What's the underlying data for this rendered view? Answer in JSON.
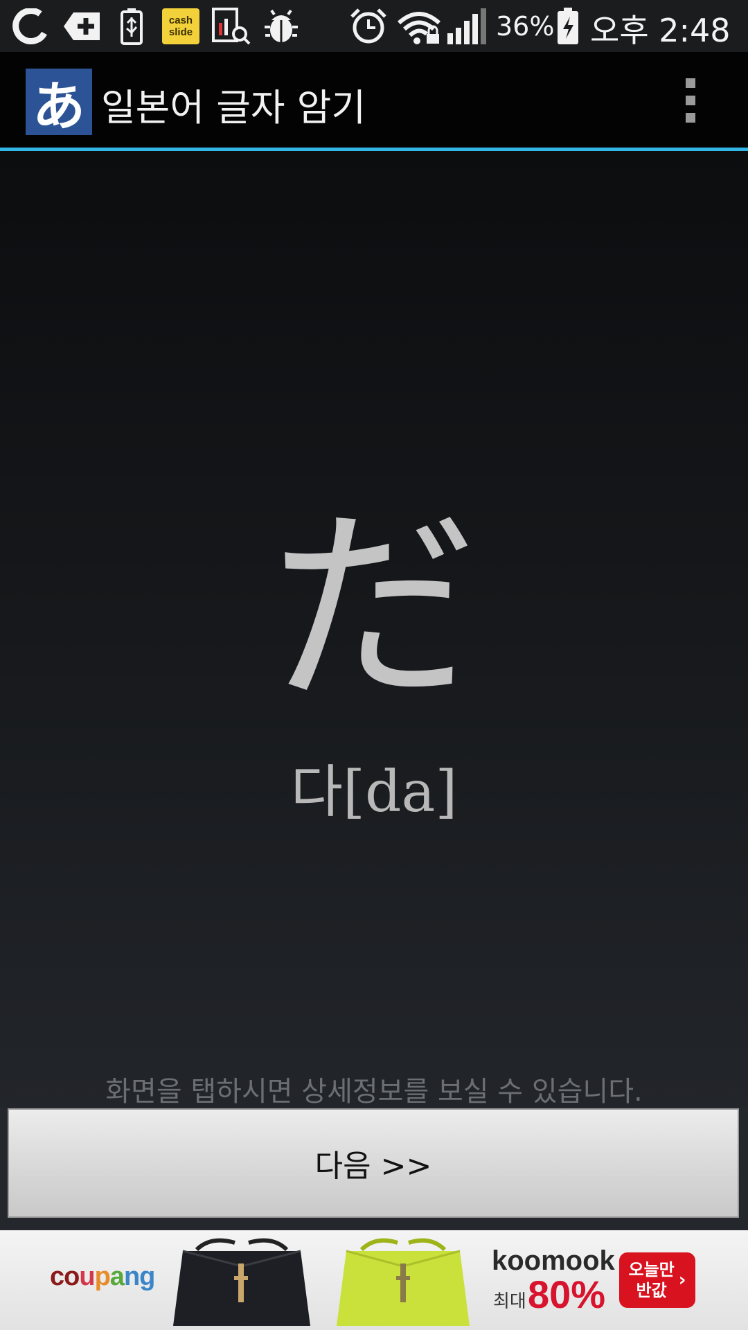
{
  "status_bar": {
    "battery_percent": "36%",
    "time": "오후 2:48",
    "cash_badge_line1": "cash",
    "cash_badge_line2": "slide",
    "icons": [
      "opera-icon",
      "plus-icon",
      "usb-battery-icon",
      "cashslide-icon",
      "search-report-icon",
      "android-bug-icon",
      "alarm-icon",
      "wifi-lock-icon",
      "signal-icon",
      "battery-charging-icon"
    ]
  },
  "action_bar": {
    "logo_glyph": "あ",
    "title": "일본어 글자 암기",
    "accent_color": "#33b5e5"
  },
  "card": {
    "kana": "だ",
    "reading": "다[da]"
  },
  "hint": "화면을 탭하시면 상세정보를 보실 수 있습니다.",
  "next_button_label": "다음 >>",
  "ad": {
    "logo_parts": [
      "co",
      "u",
      "p",
      "a",
      "ng"
    ],
    "brand": "koomook",
    "max_label": "최대",
    "discount": "80%",
    "cta_line1": "오늘만",
    "cta_line2": "반값",
    "cta_arrow": "›"
  }
}
